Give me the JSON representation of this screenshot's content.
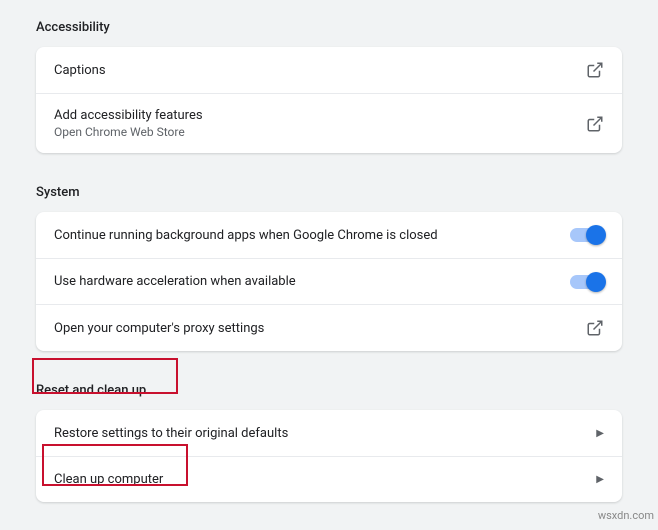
{
  "sections": {
    "accessibility": {
      "title": "Accessibility",
      "captions": "Captions",
      "addFeatures": "Add accessibility features",
      "addFeaturesSub": "Open Chrome Web Store"
    },
    "system": {
      "title": "System",
      "bgApps": "Continue running background apps when Google Chrome is closed",
      "hwAccel": "Use hardware acceleration when available",
      "proxy": "Open your computer's proxy settings"
    },
    "reset": {
      "title": "Reset and clean up",
      "restore": "Restore settings to their original defaults",
      "cleanup": "Clean up computer"
    }
  },
  "watermark": "wsxdn.com"
}
